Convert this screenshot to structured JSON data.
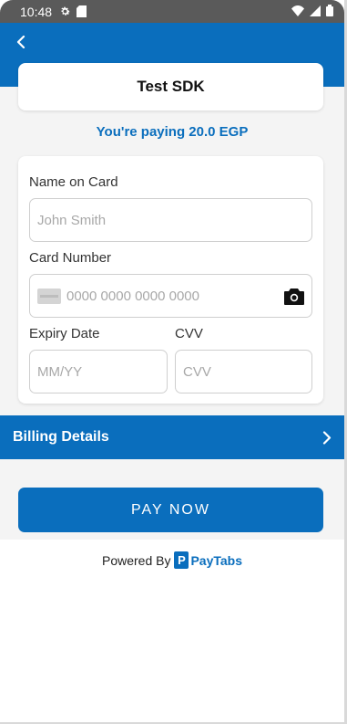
{
  "status_bar": {
    "time": "10:48"
  },
  "header": {
    "title": "Test SDK"
  },
  "payment": {
    "amount_text": "You're paying 20.0 EGP"
  },
  "form": {
    "name_label": "Name on Card",
    "name_placeholder": "John Smith",
    "card_label": "Card Number",
    "card_placeholder": "0000 0000 0000 0000",
    "expiry_label": "Expiry Date",
    "expiry_placeholder": "MM/YY",
    "cvv_label": "CVV",
    "cvv_placeholder": "CVV"
  },
  "billing": {
    "label": "Billing Details"
  },
  "actions": {
    "pay_label": "PAY NOW"
  },
  "footer": {
    "powered_by": "Powered By",
    "brand": "PayTabs"
  },
  "colors": {
    "brand_blue": "#0a6ebd",
    "status_bar": "#5a5a5a",
    "background": "#f4f4f4"
  },
  "icons": {
    "back": "back-arrow-icon",
    "settings": "gear-icon",
    "sim": "sim-card-icon",
    "wifi": "wifi-icon",
    "signal": "signal-icon",
    "battery": "battery-icon",
    "card": "credit-card-icon",
    "camera": "camera-icon",
    "chevron": "chevron-right-icon"
  }
}
